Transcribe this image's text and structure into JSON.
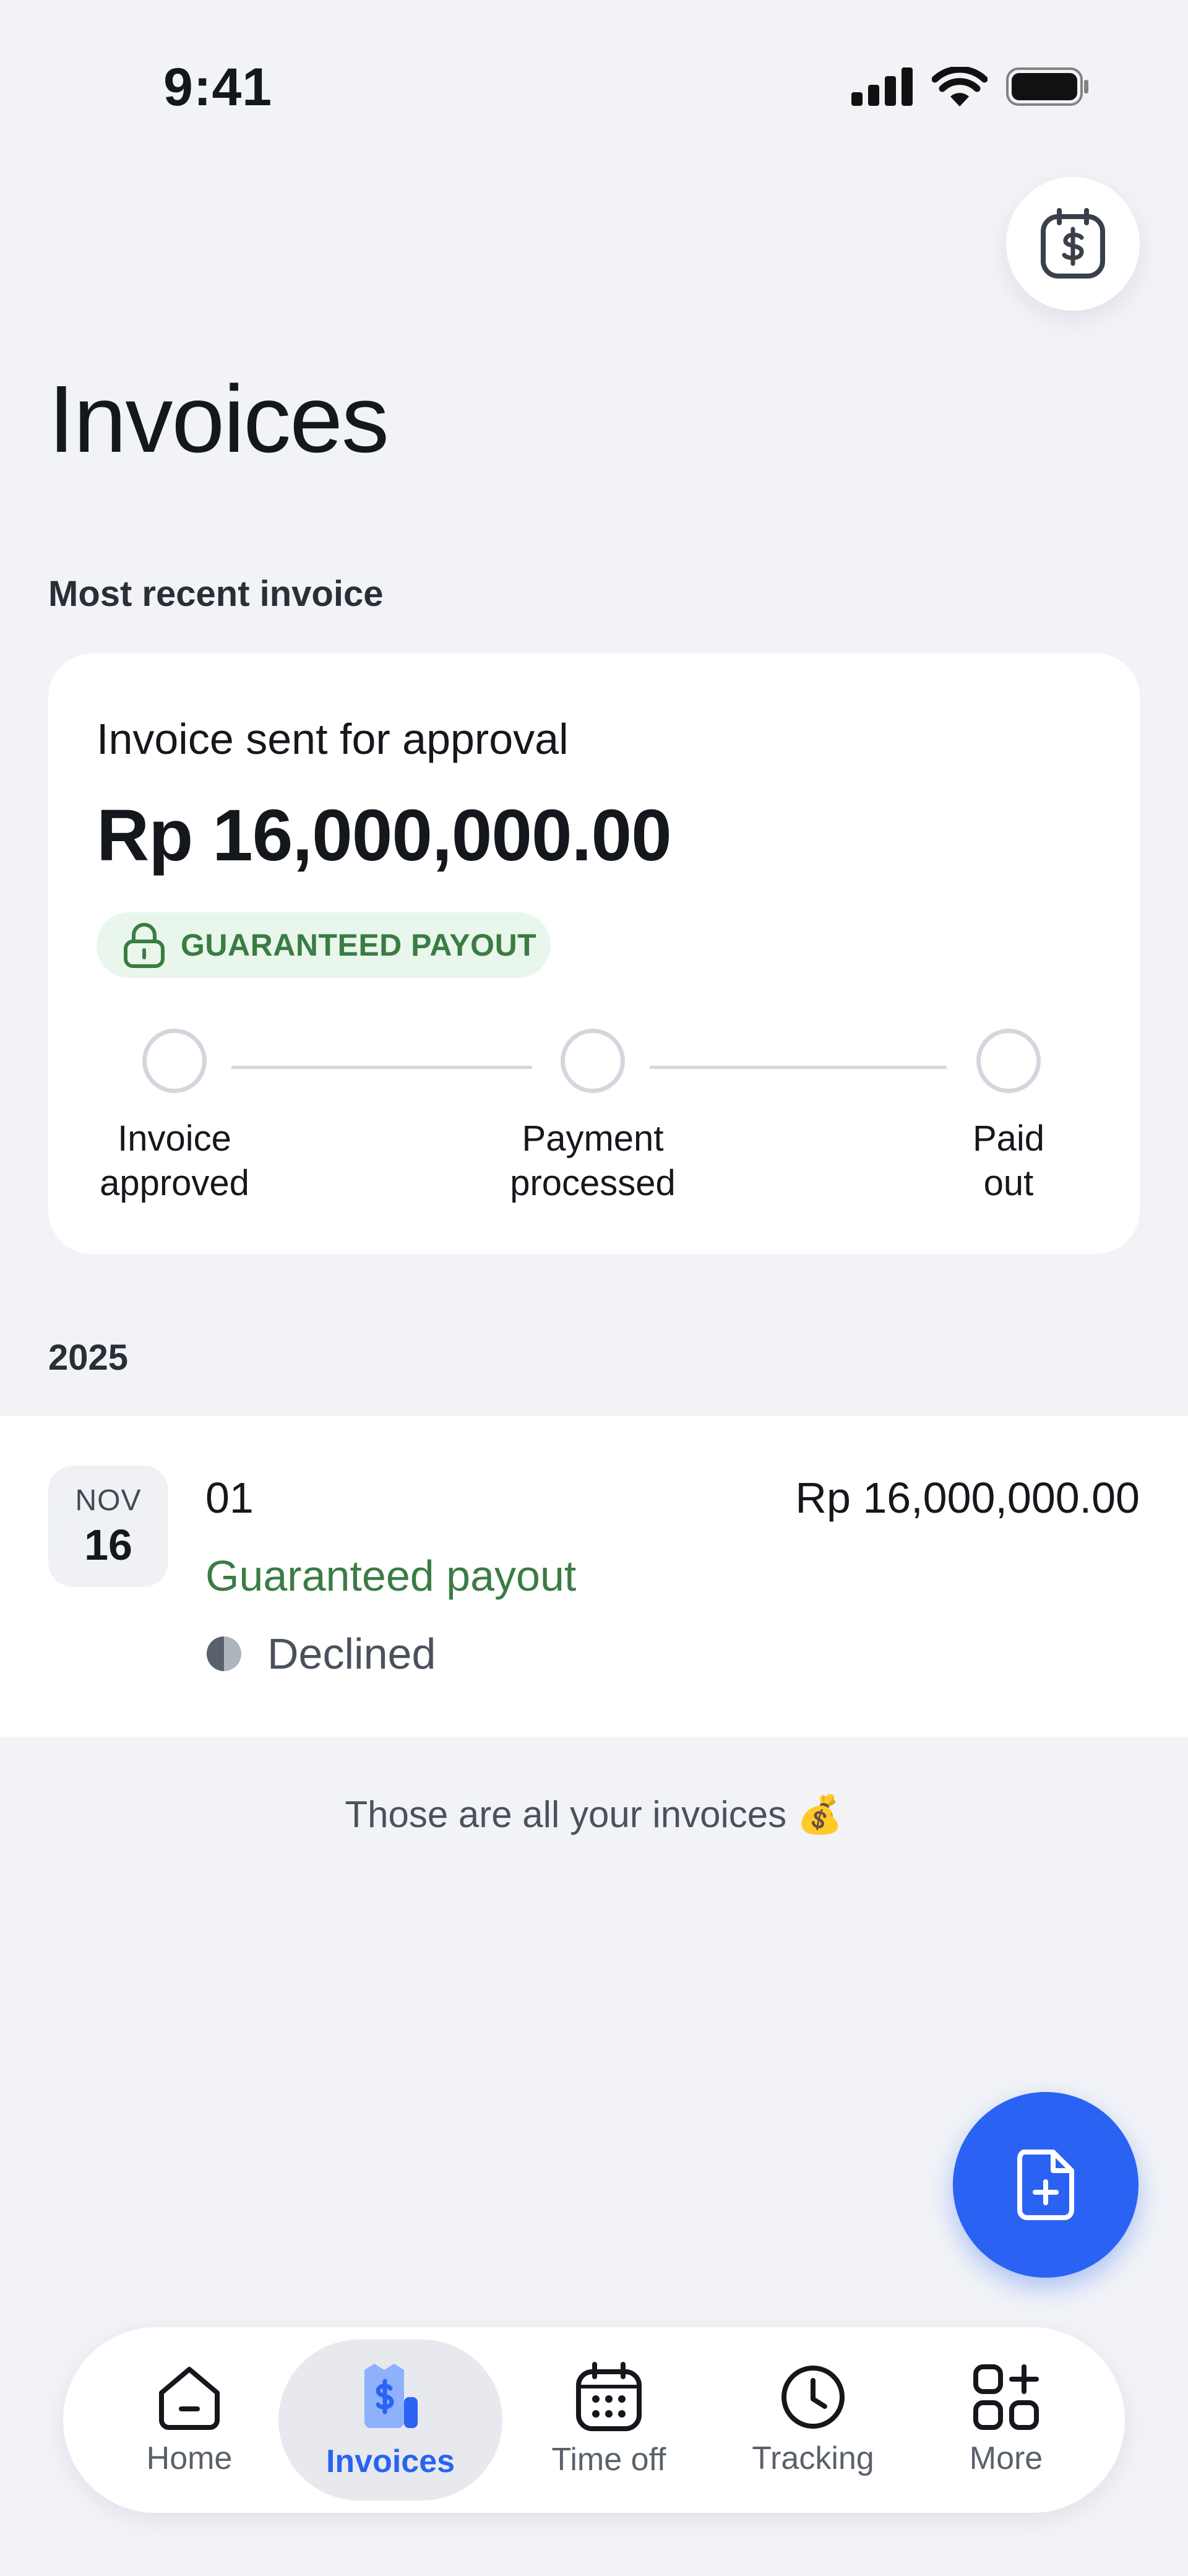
{
  "status_bar": {
    "time": "9:41"
  },
  "page": {
    "title": "Invoices"
  },
  "recent": {
    "section_label": "Most recent invoice",
    "status": "Invoice sent for approval",
    "amount": "Rp 16,000,000.00",
    "badge": "GUARANTEED PAYOUT",
    "steps": [
      {
        "line1": "Invoice",
        "line2": "approved"
      },
      {
        "line1": "Payment",
        "line2": "processed"
      },
      {
        "line1": "Paid",
        "line2": "out"
      }
    ]
  },
  "list": {
    "year_label": "2025",
    "items": [
      {
        "month": "NOV",
        "day": "16",
        "number": "01",
        "amount": "Rp 16,000,000.00",
        "payout": "Guaranteed payout",
        "state": "Declined"
      }
    ],
    "footer": "Those are all your invoices 💰"
  },
  "nav": {
    "items": [
      {
        "label": "Home",
        "icon": "home-icon"
      },
      {
        "label": "Invoices",
        "icon": "invoice-icon",
        "active": true
      },
      {
        "label": "Time off",
        "icon": "calendar-icon"
      },
      {
        "label": "Tracking",
        "icon": "clock-icon"
      },
      {
        "label": "More",
        "icon": "grid-plus-icon"
      }
    ]
  },
  "colors": {
    "accent": "#2a63f3",
    "success": "#3a7c43",
    "badge_bg": "#e9f6ec",
    "background": "#f1f3f7"
  }
}
